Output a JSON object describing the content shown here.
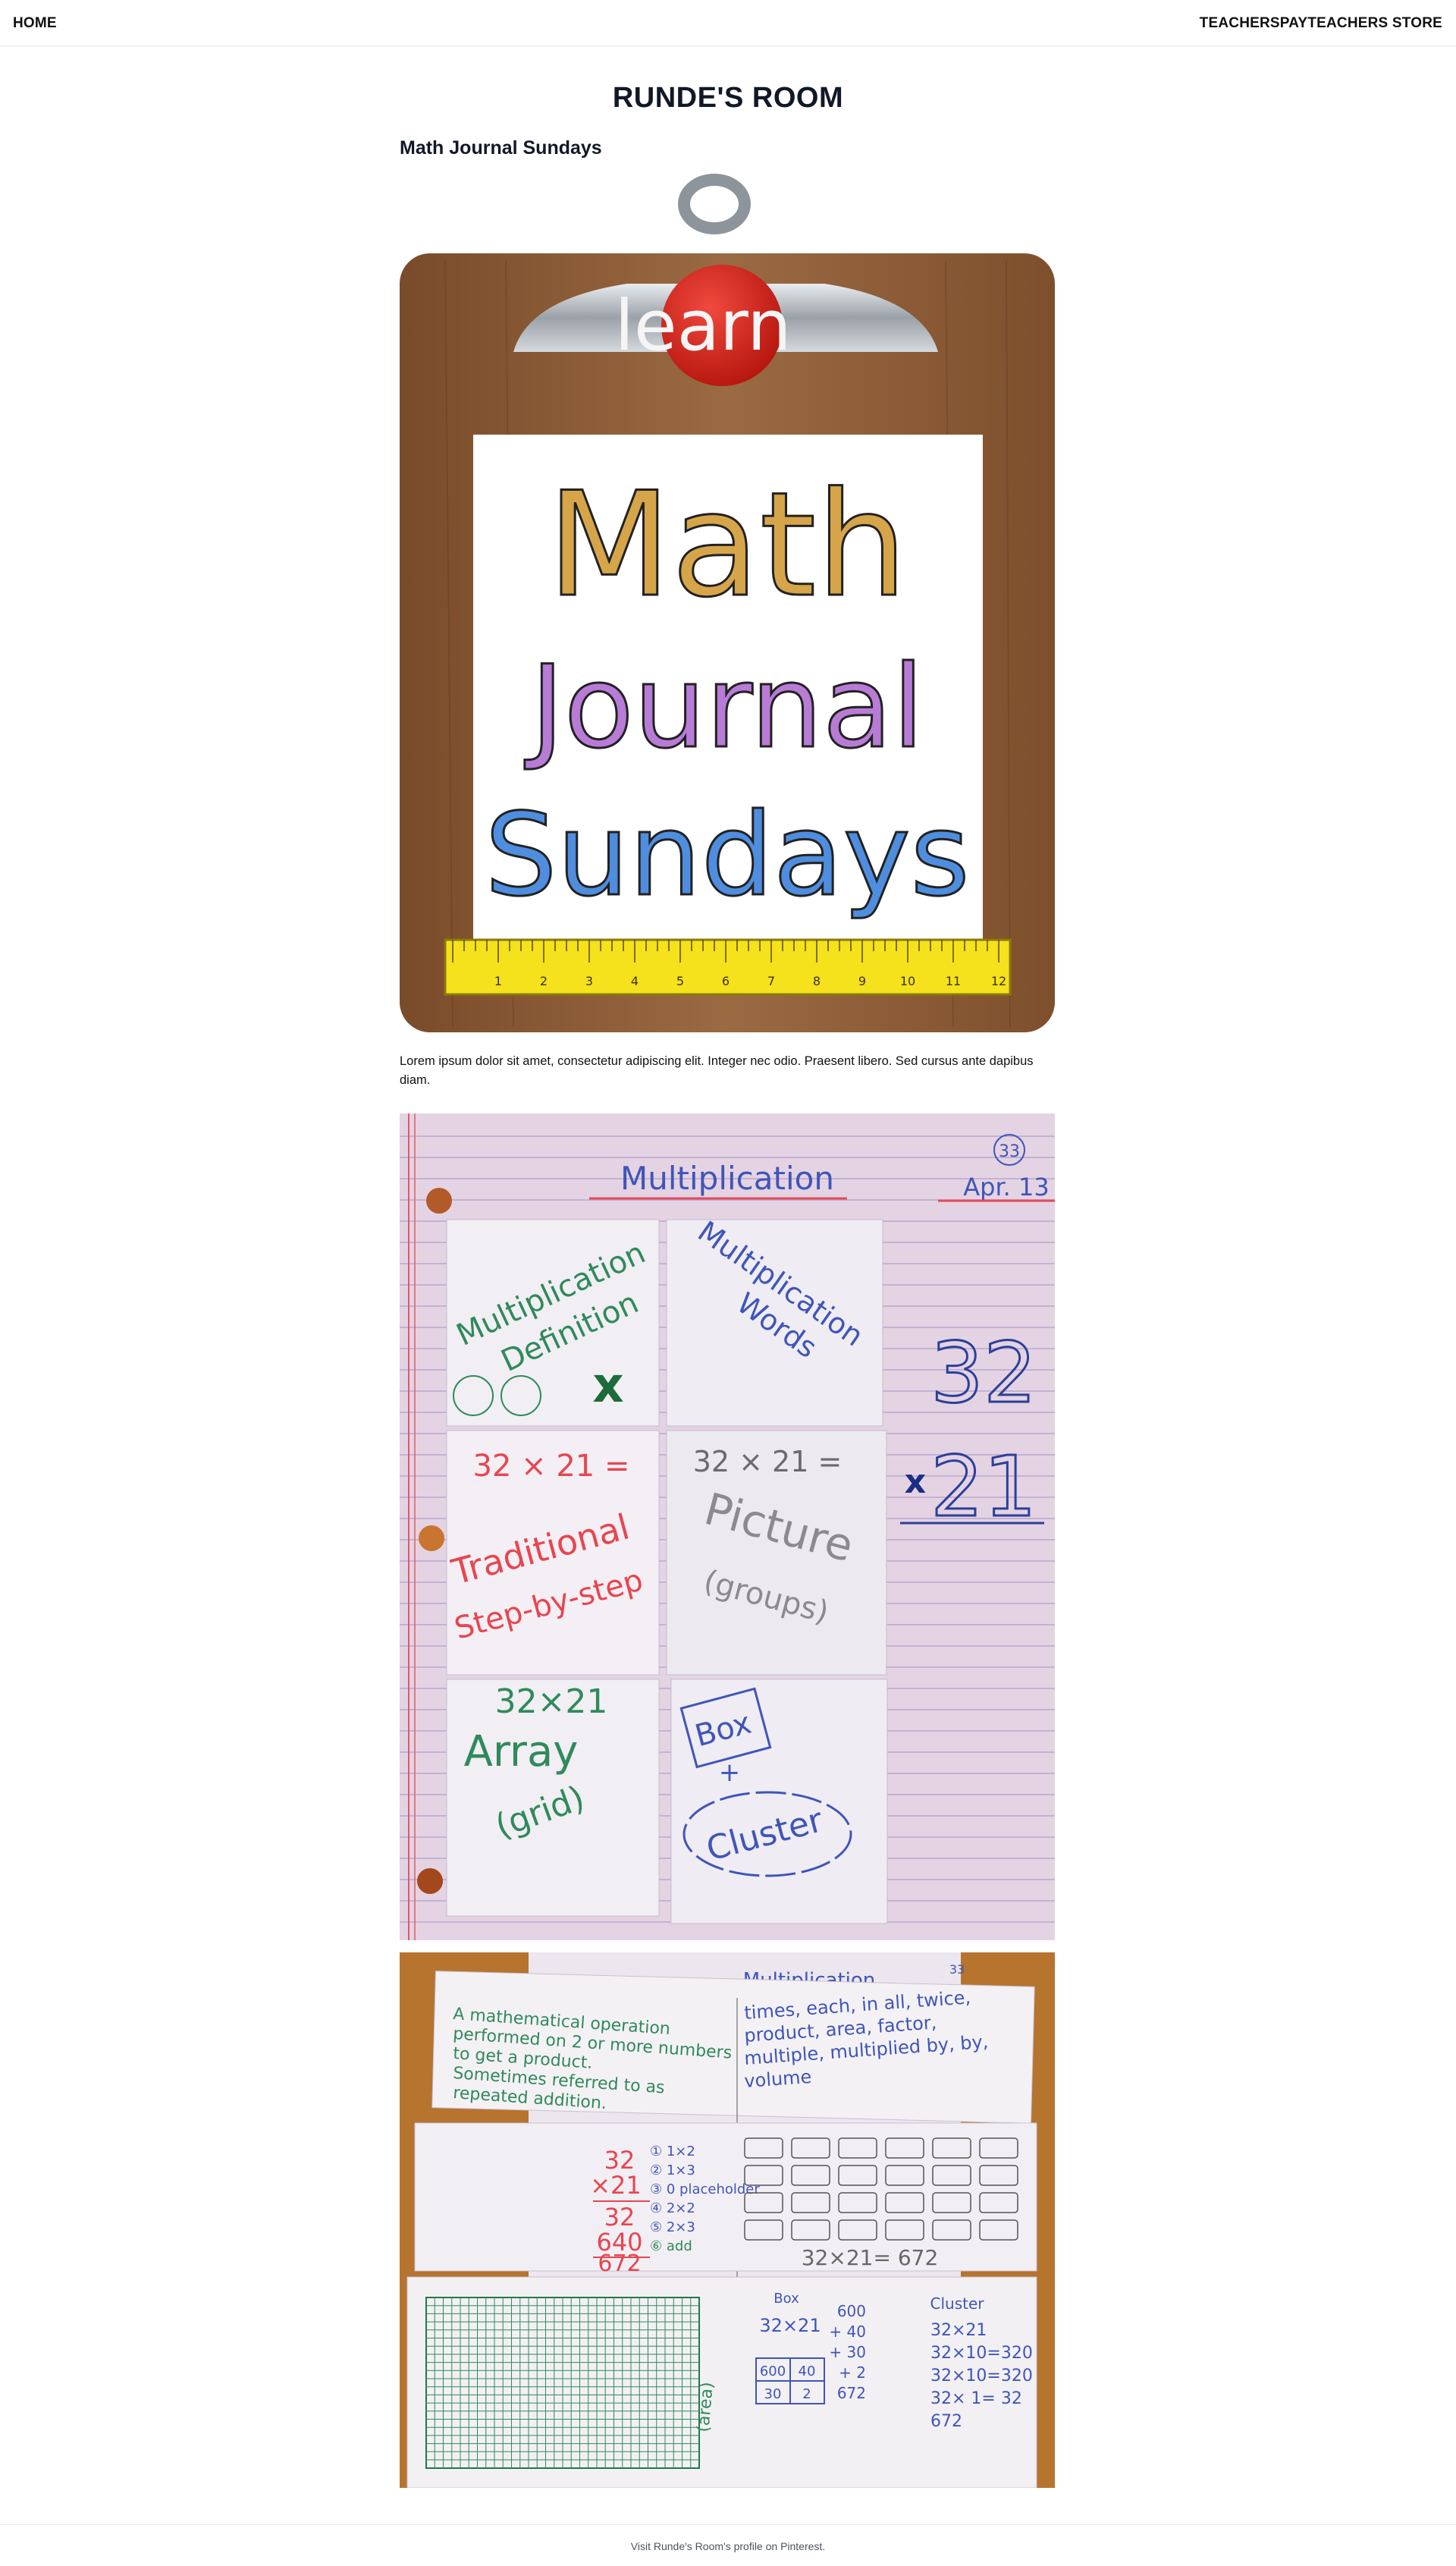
{
  "nav": {
    "home_label": "HOME",
    "store_label": "TEACHERSPAYTEACHERS STORE"
  },
  "site": {
    "title": "RUNDE'S ROOM"
  },
  "post": {
    "title": "Math Journal Sundays",
    "body": "Lorem ipsum dolor sit amet, consectetur adipiscing elit. Integer nec odio. Praesent libero. Sed cursus ante dapibus diam."
  },
  "hero_image": {
    "badge_text": "learn",
    "line1": "Math",
    "line2": "Journal",
    "line3": "Sundays",
    "ruler_numbers": [
      "1",
      "2",
      "3",
      "4",
      "5",
      "6",
      "7",
      "8",
      "9",
      "10",
      "11",
      "12"
    ],
    "colors": {
      "wood": "#8a5a35",
      "badge": "#d92a20",
      "ruler": "#f5e11c"
    }
  },
  "photo1": {
    "heading": "Multiplication",
    "page_num": "33",
    "date": "Apr. 13",
    "flap1_a": "Multiplication",
    "flap1_b": "Definition",
    "flap2_a": "Multiplication",
    "flap2_b": "Words",
    "flap3_a": "32 × 21 =",
    "flap3_b": "Traditional",
    "flap3_c": "Step-by-step",
    "flap4_a": "32 × 21 =",
    "flap4_b": "Picture",
    "flap4_c": "(groups)",
    "flap5_a": "32×21",
    "flap5_b": "Array",
    "flap5_c": "(grid)",
    "flap6_a": "Box",
    "flap6_b": "+",
    "flap6_c": "Cluster",
    "side_top": "32",
    "side_bottom": "21",
    "side_sign": "x"
  },
  "photo2": {
    "heading": "Multiplication",
    "page_num": "33",
    "def_lines": [
      "A mathematical operation",
      "performed on 2 or more numbers",
      "to get a product.",
      "Sometimes referred to as",
      "repeated addition."
    ],
    "word_lines": [
      "times, each, in all, twice,",
      "product, area, factor,",
      "multiple, multiplied by, by,",
      "volume"
    ],
    "trad_top": "32",
    "trad_mult": "×21",
    "trad_r1": "32",
    "trad_r2": "640",
    "trad_sum": "672",
    "steps": [
      "① 1×2",
      "② 1×3",
      "③ 0 placeholder",
      "④ 2×2",
      "⑤ 2×3",
      "⑥ add"
    ],
    "groups_eq": "32×21= 672",
    "array_label": "(area)",
    "box_title": "Box",
    "box_eq": "32×21",
    "box_cells": [
      "600",
      "40",
      "30",
      "2"
    ],
    "box_sum": [
      "600",
      "+ 40",
      "+ 30",
      "+ 2",
      "672"
    ],
    "cluster_title": "Cluster",
    "cluster_lines": [
      "32×21",
      "32×10=320",
      "32×10=320",
      "32× 1= 32",
      "672"
    ]
  },
  "footer": {
    "text": "Visit Runde's Room's profile on Pinterest."
  }
}
